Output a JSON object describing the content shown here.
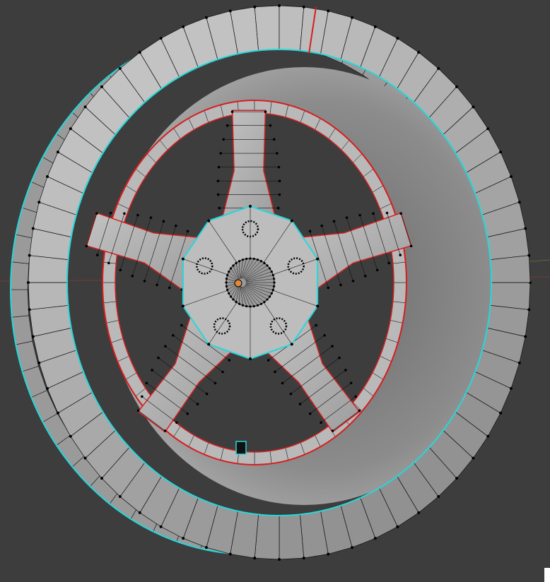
{
  "viewport": {
    "kind": "3d-mesh-edit-view",
    "object": "wheel-rim",
    "spoke_count": 5,
    "lug_hole_count": 5,
    "colors": {
      "background": "#3d3d3d",
      "mesh_face_light": "#b4b4b4",
      "mesh_face_dark": "#5a5a5a",
      "wire": "#111111",
      "vertex": "#000000",
      "selected_edge": "#25d8da",
      "seam_edge": "#d81d1d",
      "axis_x": "#8c3a3a",
      "axis_y": "#6a8a3a"
    }
  }
}
